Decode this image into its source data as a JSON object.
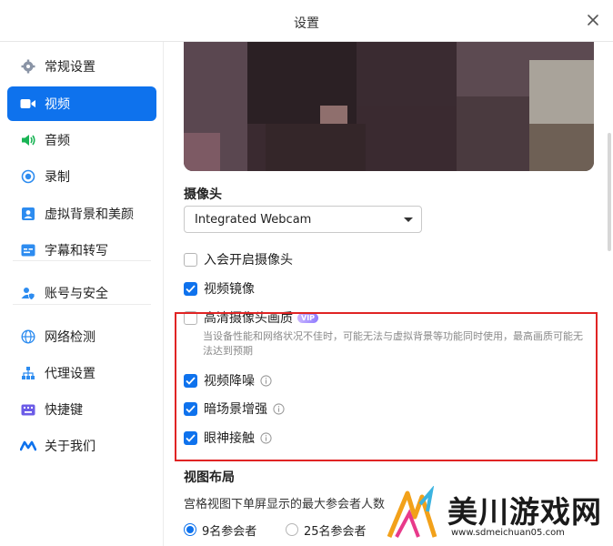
{
  "window": {
    "title": "设置"
  },
  "sidebar": {
    "items": [
      {
        "label": "常规设置",
        "icon": "gear-icon",
        "active": false
      },
      {
        "label": "视频",
        "icon": "video-camera-icon",
        "active": true
      },
      {
        "label": "音频",
        "icon": "speaker-icon",
        "active": false
      },
      {
        "label": "录制",
        "icon": "record-icon",
        "active": false
      },
      {
        "label": "虚拟背景和美颜",
        "icon": "portrait-icon",
        "active": false
      },
      {
        "label": "字幕和转写",
        "icon": "caption-icon",
        "active": false
      },
      {
        "label": "账号与安全",
        "icon": "account-shield-icon",
        "active": false
      },
      {
        "label": "网络检测",
        "icon": "globe-icon",
        "active": false
      },
      {
        "label": "代理设置",
        "icon": "network-proxy-icon",
        "active": false
      },
      {
        "label": "快捷键",
        "icon": "keyboard-icon",
        "active": false
      },
      {
        "label": "关于我们",
        "icon": "logo-icon",
        "active": false
      }
    ]
  },
  "camera": {
    "section_title": "摄像头",
    "selected": "Integrated Webcam"
  },
  "options": {
    "join_with_video": {
      "label": "入会开启摄像头",
      "checked": false
    },
    "mirror": {
      "label": "视频镜像",
      "checked": true
    },
    "hd_quality": {
      "label": "高清摄像头画质",
      "checked": false,
      "badge": "VIP"
    },
    "hd_hint": "当设备性能和网络状况不佳时，可能无法与虚拟背景等功能同时使用，最高画质可能无法达到预期",
    "noise_reduction": {
      "label": "视频降噪",
      "checked": true
    },
    "low_light": {
      "label": "暗场景增强",
      "checked": true
    },
    "eye_contact": {
      "label": "眼神接触",
      "checked": true
    }
  },
  "layout": {
    "section_title": "视图布局",
    "description": "宫格视图下单屏显示的最大参会者人数",
    "options": [
      {
        "label": "9名参会者",
        "checked": true
      },
      {
        "label": "25名参会者",
        "checked": false
      }
    ]
  },
  "watermark": {
    "brand": "美川游戏网",
    "url": "www.sdmeichuan05.com"
  },
  "colors": {
    "accent": "#0e72ed",
    "highlight_box": "#e02424"
  }
}
